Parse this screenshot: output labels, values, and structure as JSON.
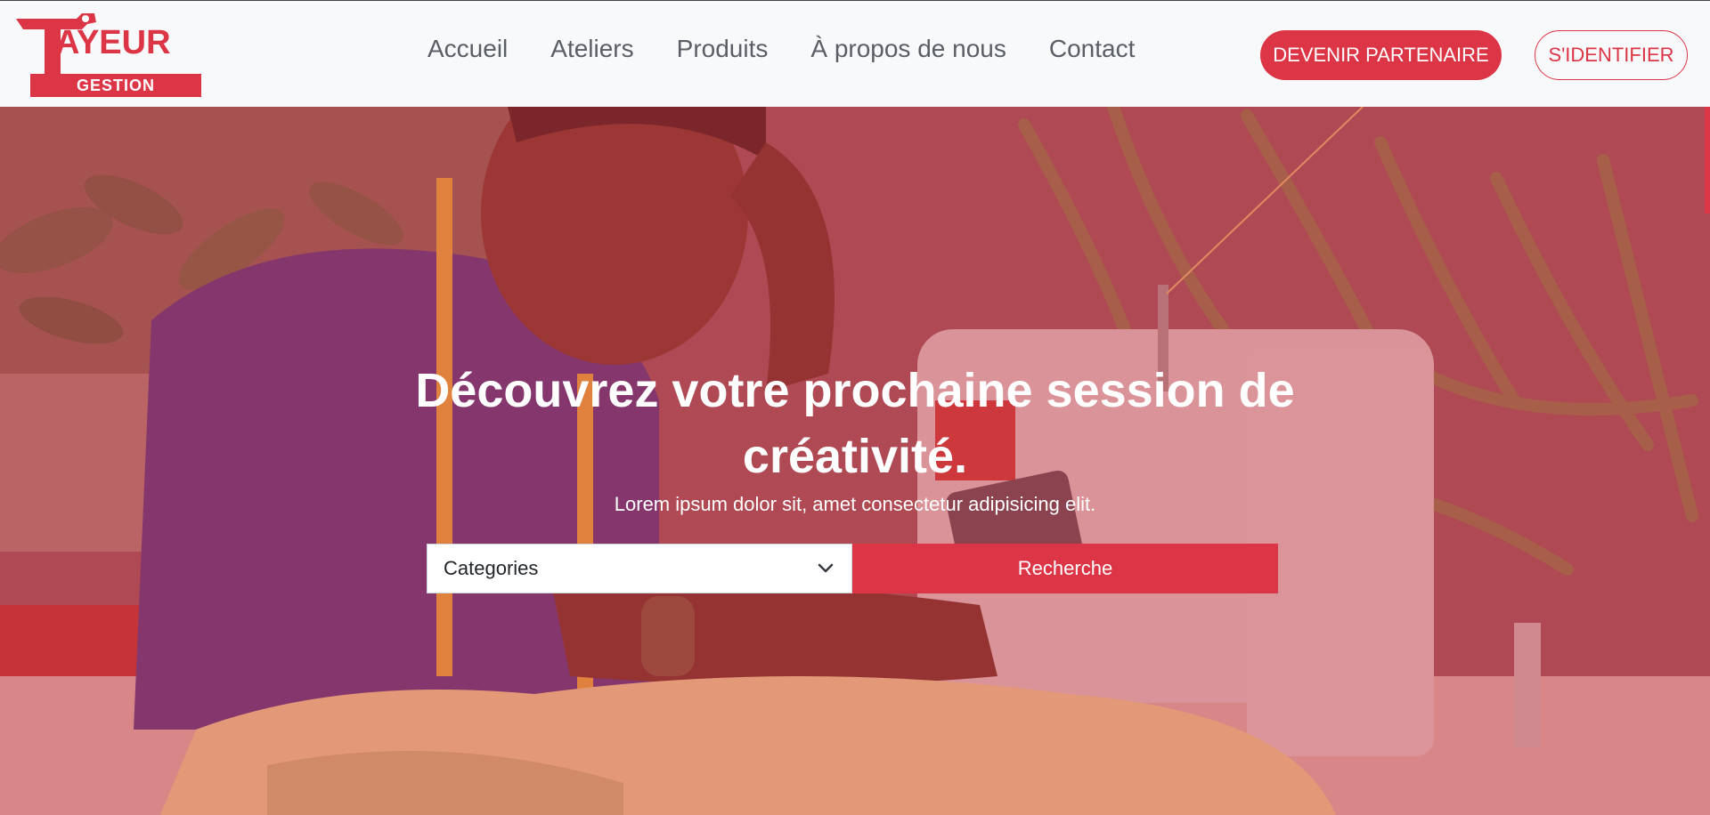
{
  "brand": {
    "logo_word": "AYEUR",
    "logo_sub": "GESTION",
    "color": "#dc3545"
  },
  "nav": {
    "links": [
      {
        "label": "Accueil"
      },
      {
        "label": "Ateliers"
      },
      {
        "label": "Produits"
      },
      {
        "label": "À propos de nous"
      },
      {
        "label": "Contact"
      }
    ],
    "partner_label": "DEVENIR PARTENAIRE",
    "login_label": "S'IDENTIFIER"
  },
  "hero": {
    "title": "Découvrez votre prochaine session de créativité.",
    "subtitle": "Lorem ipsum dolor sit, amet consectetur adipisicing elit.",
    "overlay_color": "#dc3545"
  },
  "search": {
    "category_value": "Categories",
    "button_label": "Recherche"
  }
}
